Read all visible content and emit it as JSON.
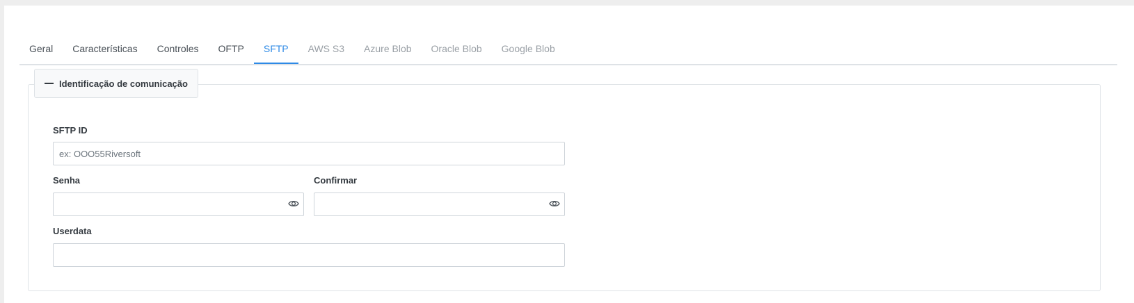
{
  "tabs": [
    {
      "label": "Geral",
      "state": "normal"
    },
    {
      "label": "Características",
      "state": "normal"
    },
    {
      "label": "Controles",
      "state": "normal"
    },
    {
      "label": "OFTP",
      "state": "normal"
    },
    {
      "label": "SFTP",
      "state": "active"
    },
    {
      "label": "AWS S3",
      "state": "dim"
    },
    {
      "label": "Azure Blob",
      "state": "dim"
    },
    {
      "label": "Oracle Blob",
      "state": "dim"
    },
    {
      "label": "Google Blob",
      "state": "dim"
    }
  ],
  "section": {
    "title": "Identificação de comunicação",
    "toggle_icon": "minus-icon"
  },
  "form": {
    "sftp_id": {
      "label": "SFTP ID",
      "value": "",
      "placeholder": "ex: OOO55Riversoft"
    },
    "senha": {
      "label": "Senha",
      "value": "",
      "icon": "eye-icon"
    },
    "confirmar": {
      "label": "Confirmar",
      "value": "",
      "icon": "eye-icon"
    },
    "userdata": {
      "label": "Userdata",
      "value": ""
    }
  },
  "colors": {
    "accent": "#2e8ae6",
    "border": "#dee2e6",
    "text": "#343a40"
  }
}
